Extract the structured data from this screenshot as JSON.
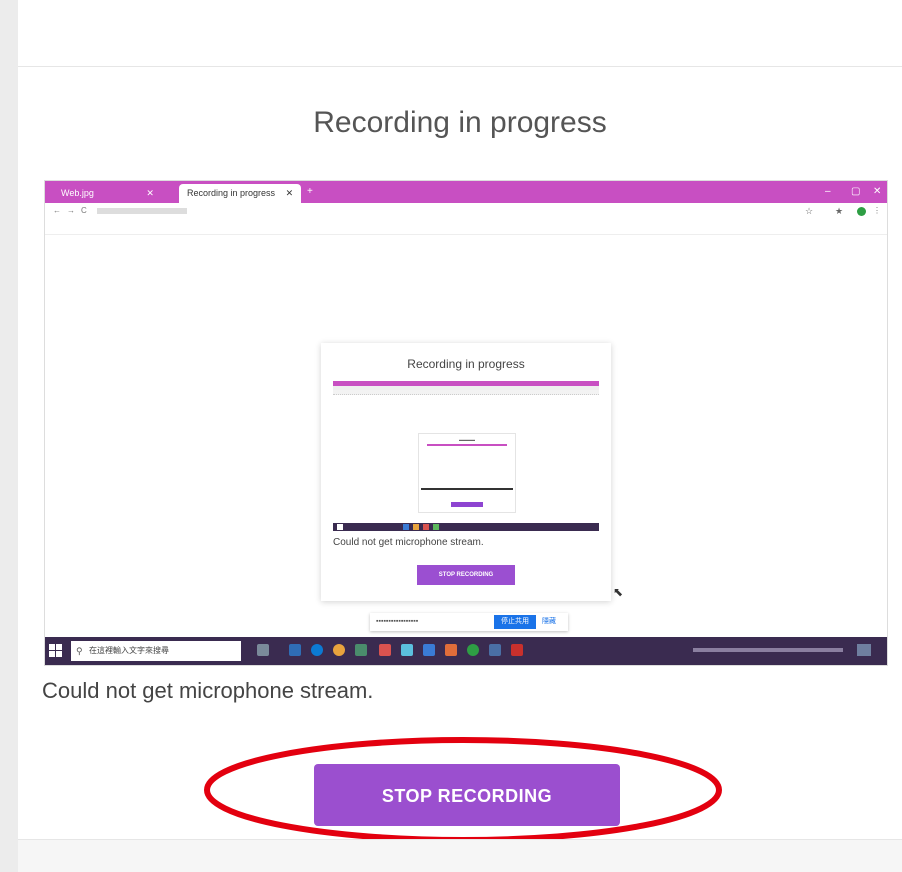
{
  "page": {
    "title": "Recording in progress",
    "message": "Could not get microphone stream.",
    "stop_button": "STOP RECORDING"
  },
  "screenshot": {
    "browser": {
      "tabs": [
        {
          "label": "Web.jpg"
        },
        {
          "label": "Recording in progress"
        }
      ],
      "new_tab": "+"
    },
    "inner": {
      "title": "Recording in progress",
      "message": "Could not get microphone stream.",
      "button": "STOP RECORDING"
    },
    "share_bar": {
      "stop_label": "停止共用",
      "hide_label": "隱藏"
    },
    "taskbar": {
      "search_placeholder": "在這裡輸入文字來搜尋"
    }
  },
  "colors": {
    "accent": "#9b4fcf",
    "browser_tab_bar": "#c84fc2",
    "taskbar": "#3a2b50",
    "annotation": "#e3000f"
  },
  "icons": [
    "windows-start-icon",
    "search-icon",
    "mouse-cursor-icon",
    "close-tab-icon"
  ]
}
